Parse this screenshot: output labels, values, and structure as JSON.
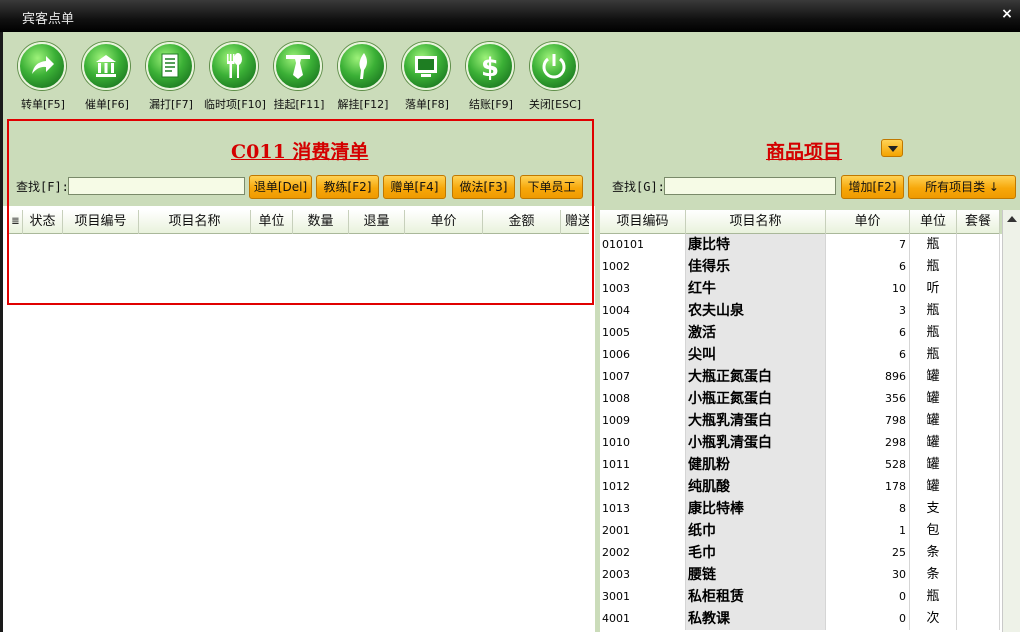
{
  "window": {
    "title": "宾客点单",
    "close_glyph": "×"
  },
  "toolbar": [
    {
      "label": "转单[F5]",
      "icon": "arrow-forward-icon"
    },
    {
      "label": "催单[F6]",
      "icon": "bank-building-icon"
    },
    {
      "label": "漏打[F7]",
      "icon": "document-icon"
    },
    {
      "label": "临时项[F10]",
      "icon": "fork-spoon-icon"
    },
    {
      "label": "挂起[F11]",
      "icon": "tie-icon"
    },
    {
      "label": "解挂[F12]",
      "icon": "knife-icon"
    },
    {
      "label": "落单[F8]",
      "icon": "monitor-icon"
    },
    {
      "label": "结账[F9]",
      "icon": "dollar-icon"
    },
    {
      "label": "关闭[ESC]",
      "icon": "power-icon"
    }
  ],
  "left": {
    "title": "C011  消费清单",
    "search_label": "查找[F]:",
    "search_value": "",
    "buttons": [
      "退单[Del]",
      "教练[F2]",
      "赠单[F4]",
      "做法[F3]",
      "下单员工"
    ],
    "columns": [
      "状态",
      "项目编号",
      "项目名称",
      "单位",
      "数量",
      "退量",
      "单价",
      "金额",
      "赠送"
    ]
  },
  "right": {
    "title": "商品项目",
    "search_label": "查找[G]:",
    "search_value": "",
    "add_button": "增加[F2]",
    "category_button": "所有项目类 ↓",
    "columns": [
      "项目编码",
      "项目名称",
      "单价",
      "单位",
      "套餐"
    ],
    "rows": [
      {
        "code": "010101",
        "name": "康比特",
        "price": "7",
        "unit": "瓶"
      },
      {
        "code": "1002",
        "name": "佳得乐",
        "price": "6",
        "unit": "瓶"
      },
      {
        "code": "1003",
        "name": "红牛",
        "price": "10",
        "unit": "听"
      },
      {
        "code": "1004",
        "name": "农夫山泉",
        "price": "3",
        "unit": "瓶"
      },
      {
        "code": "1005",
        "name": "激活",
        "price": "6",
        "unit": "瓶"
      },
      {
        "code": "1006",
        "name": "尖叫",
        "price": "6",
        "unit": "瓶"
      },
      {
        "code": "1007",
        "name": "大瓶正氮蛋白",
        "price": "896",
        "unit": "罐"
      },
      {
        "code": "1008",
        "name": "小瓶正氮蛋白",
        "price": "356",
        "unit": "罐"
      },
      {
        "code": "1009",
        "name": "大瓶乳清蛋白",
        "price": "798",
        "unit": "罐"
      },
      {
        "code": "1010",
        "name": "小瓶乳清蛋白",
        "price": "298",
        "unit": "罐"
      },
      {
        "code": "1011",
        "name": "健肌粉",
        "price": "528",
        "unit": "罐"
      },
      {
        "code": "1012",
        "name": "纯肌酸",
        "price": "178",
        "unit": "罐"
      },
      {
        "code": "1013",
        "name": "康比特棒",
        "price": "8",
        "unit": "支"
      },
      {
        "code": "2001",
        "name": "纸巾",
        "price": "1",
        "unit": "包"
      },
      {
        "code": "2002",
        "name": "毛巾",
        "price": "25",
        "unit": "条"
      },
      {
        "code": "2003",
        "name": "腰链",
        "price": "30",
        "unit": "条"
      },
      {
        "code": "3001",
        "name": "私柜租赁",
        "price": "0",
        "unit": "瓶"
      },
      {
        "code": "4001",
        "name": "私教课",
        "price": "0",
        "unit": "次"
      }
    ]
  }
}
